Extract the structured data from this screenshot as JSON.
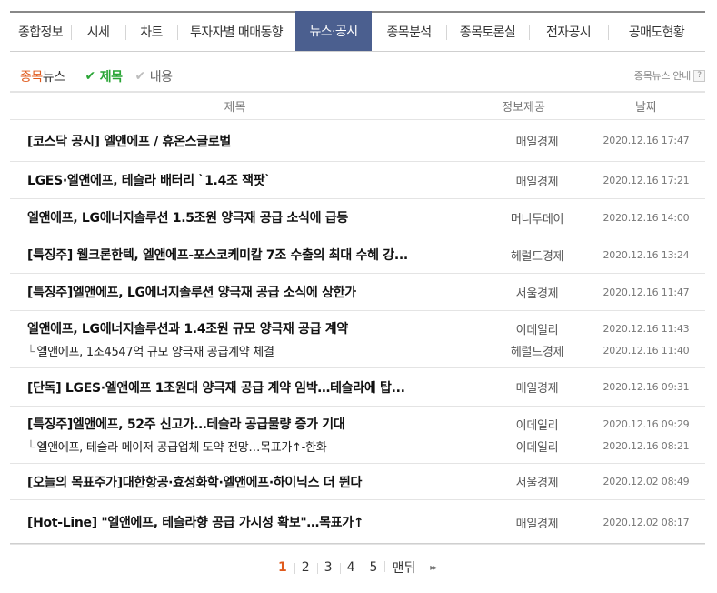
{
  "tabs": [
    {
      "label": "종합정보",
      "width": 67
    },
    {
      "label": "시세",
      "width": 60
    },
    {
      "label": "차트",
      "width": 57
    },
    {
      "label": "투자자별 매매동향",
      "width": 130
    },
    {
      "label": "뉴스·공시",
      "width": 84,
      "active": true
    },
    {
      "label": "종목분석",
      "width": 82
    },
    {
      "label": "종목토론실",
      "width": 91
    },
    {
      "label": "전자공시",
      "width": 87
    },
    {
      "label": "공매도현황",
      "width": 107
    }
  ],
  "filter": {
    "title_accent": "종목",
    "title_rest": "뉴스",
    "option_title": "제목",
    "option_content": "내용",
    "guide": "종목뉴스 안내",
    "guide_icon": "?"
  },
  "table": {
    "headers": {
      "title": "제목",
      "source": "정보제공",
      "date": "날짜"
    },
    "groups": [
      {
        "height": 46,
        "rows": [
          {
            "title": "[코스닥 공시] 엘앤에프 / 휴온스글로벌",
            "source": "매일경제",
            "date": "2020.12.16 17:47"
          }
        ]
      },
      {
        "height": 41,
        "rows": [
          {
            "title": "LGES·엘앤에프, 테슬라 배터리 `1.4조 잭팟`",
            "source": "매일경제",
            "date": "2020.12.16 17:21"
          }
        ]
      },
      {
        "height": 41,
        "rows": [
          {
            "title": "엘앤에프, LG에너지솔루션 1.5조원 양극재 공급 소식에 급등",
            "source": "머니투데이",
            "date": "2020.12.16 14:00"
          }
        ]
      },
      {
        "height": 41,
        "rows": [
          {
            "title": "[특징주] 웰크론한텍, 엘앤에프-포스코케미칼 7조 수출의 최대 수혜 강...",
            "source": "헤럴드경제",
            "date": "2020.12.16 13:24"
          }
        ]
      },
      {
        "height": 41,
        "rows": [
          {
            "title": "[특징주]엘앤에프, LG에너지솔루션 양극재 공급 소식에 상한가",
            "source": "서울경제",
            "date": "2020.12.16 11:47"
          }
        ]
      },
      {
        "height": 63,
        "rows": [
          {
            "title": "엘앤에프, LG에너지솔루션과 1.4조원 규모 양극재 공급 계약",
            "source": "이데일리",
            "date": "2020.12.16 11:43"
          },
          {
            "title": "엘앤에프, 1조4547억 규모 양극재 공급계약 체결",
            "source": "헤럴드경제",
            "date": "2020.12.16 11:40",
            "sub": true
          }
        ]
      },
      {
        "height": 42,
        "rows": [
          {
            "title": "[단독] LGES·엘앤에프 1조원대 양극재 공급 계약 임박…테슬라에 탑...",
            "source": "매일경제",
            "date": "2020.12.16 09:31"
          }
        ]
      },
      {
        "height": 63,
        "rows": [
          {
            "title": "[특징주]엘앤에프, 52주 신고가…테슬라 공급물량 증가 기대",
            "source": "이데일리",
            "date": "2020.12.16 09:29"
          },
          {
            "title": "엘앤에프, 테슬라 메이저 공급업체 도약 전망…목표가↑-한화",
            "source": "이데일리",
            "date": "2020.12.16 08:21",
            "sub": true
          }
        ]
      },
      {
        "height": 40,
        "rows": [
          {
            "title": "[오늘의 목표주가]대한항공·효성화학·엘앤에프·하이닉스 더 뛴다",
            "source": "서울경제",
            "date": "2020.12.02 08:49"
          }
        ]
      },
      {
        "height": 49,
        "rows": [
          {
            "title": "[Hot-Line] \"엘앤에프, 테슬라향 공급 가시성 확보\"…목표가↑",
            "source": "매일경제",
            "date": "2020.12.02 08:17"
          }
        ]
      }
    ],
    "sub_prefix": "└"
  },
  "pagination": {
    "pages": [
      "1",
      "2",
      "3",
      "4",
      "5"
    ],
    "current": "1",
    "last_label": "맨뒤",
    "next_icon": "▸▸"
  }
}
